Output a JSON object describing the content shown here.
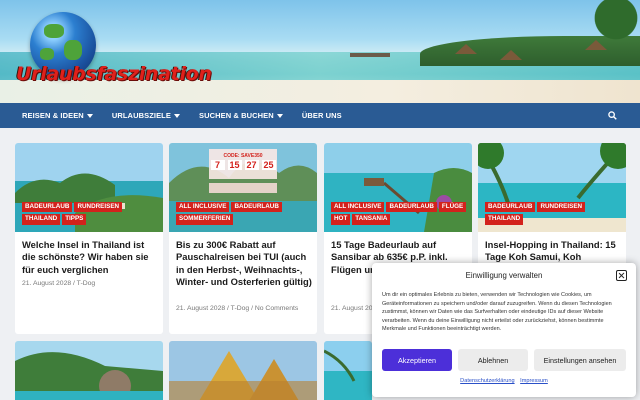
{
  "site": {
    "logo_text": "Urlaubsfaszination"
  },
  "nav": {
    "items": [
      {
        "label": "REISEN & IDEEN",
        "has_dropdown": true
      },
      {
        "label": "URLAUBSZIELE",
        "has_dropdown": true
      },
      {
        "label": "SUCHEN & BUCHEN",
        "has_dropdown": true
      },
      {
        "label": "ÜBER UNS",
        "has_dropdown": false
      }
    ],
    "background": "#2a5b94"
  },
  "posts": [
    {
      "tags": [
        "BADEURLAUB",
        "RUNDREISEN",
        "THAILAND",
        "TIPPS"
      ],
      "title": "Welche Insel in Thailand ist die schönste? Wir haben sie für euch verglichen",
      "meta": "21. August 2028 / T-Dog"
    },
    {
      "tags": [
        "ALL INCLUSIVE",
        "BADEURLAUB",
        "SOMMERFERIEN"
      ],
      "title": "Bis zu 300€ Rabatt auf Pauschalreisen bei TUI (auch in den Herbst-, Weihnachts-, Winter- und Osterferien gültig)",
      "meta": "21. August 2028 / T-Dog / No Comments",
      "image_text": {
        "code": "CODE: SAVE350",
        "counter": [
          "7",
          "15",
          "27",
          "25"
        ]
      }
    },
    {
      "tags": [
        "ALL INCLUSIVE",
        "BADEURLAUB",
        "FLÜGE",
        "HOT",
        "TANSANIA"
      ],
      "title": "15 Tage Badeurlaub auf Sansibar ab 635€ p.P. inkl. Flügen und Frühstück 1.241€)",
      "meta": "21. August 2028"
    },
    {
      "tags": [
        "BADEURLAUB",
        "RUNDREISEN",
        "THAILAND"
      ],
      "title": "Insel-Hopping in Thailand: 15 Tage Koh Samui, Koh",
      "meta": ""
    }
  ],
  "consent": {
    "title": "Einwilligung verwalten",
    "body": "Um dir ein optimales Erlebnis zu bieten, verwenden wir Technologien wie Cookies, um Geräteinformationen zu speichern und/oder darauf zuzugreifen. Wenn du diesen Technologien zustimmst, können wir Daten wie das Surfverhalten oder eindeutige IDs auf dieser Website verarbeiten. Wenn du deine Einwilligung nicht erteilst oder zurückziehst, können bestimmte Merkmale und Funktionen beeinträchtigt werden.",
    "accept": "Akzeptieren",
    "reject": "Ablehnen",
    "settings": "Einstellungen ansehen",
    "privacy_link": "Datenschutzerklärung",
    "imprint_link": "Impressum",
    "accent": "#4c2fd9"
  },
  "colors": {
    "tag": "#d3221c",
    "logo": "#e0201b"
  }
}
